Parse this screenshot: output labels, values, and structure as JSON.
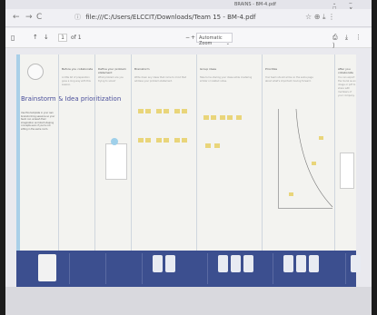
{
  "browser": {
    "tab_title": "BRAINS - BM-4.pdf",
    "window_controls": "⌄ − ☐ ×",
    "url": "file:///C:/Users/ELCCIT/Downloads/Team 15 - BM-4.pdf",
    "nav_back": "←",
    "nav_forward": "→",
    "nav_reload": "C",
    "right_icons": "☆ ⊕ ⤓ ⋮"
  },
  "pdf_viewer": {
    "page_current": "1",
    "page_total": "of 1",
    "zoom_minus": "−",
    "zoom_plus": "+",
    "zoom_value": "Automatic Zoom",
    "tools": "⎙ ⤓ ⋮ ⟩"
  },
  "board": {
    "title": "Brainstorm & Idea prioritization",
    "body": "Use this template in your own brainstorming sessions so your team can unleash their imagination and start shaping concepts even if you're not sitting in the same room.",
    "columns": [
      {
        "header": "Before you collaborate",
        "text": "A little bit of preparation goes a long way with this session."
      },
      {
        "header": "Define your problem statement",
        "text": "What problem are you trying to solve?"
      },
      {
        "header": "Brainstorm",
        "text": "Write down any ideas that come to mind that address your problem statement."
      },
      {
        "header": "Group ideas",
        "text": "Take turns sharing your ideas while clustering similar or related notes."
      },
      {
        "header": "Prioritize",
        "text": "Your team should all be on the same page about what's important moving forward."
      },
      {
        "header": "After you collaborate",
        "text": "You can export the mural as an image or pdf to share with members of your company."
      }
    ]
  },
  "colors": {
    "footer": "#3c4f8f",
    "sticky": "#e9d57a",
    "accent": "#4a4f9a"
  }
}
